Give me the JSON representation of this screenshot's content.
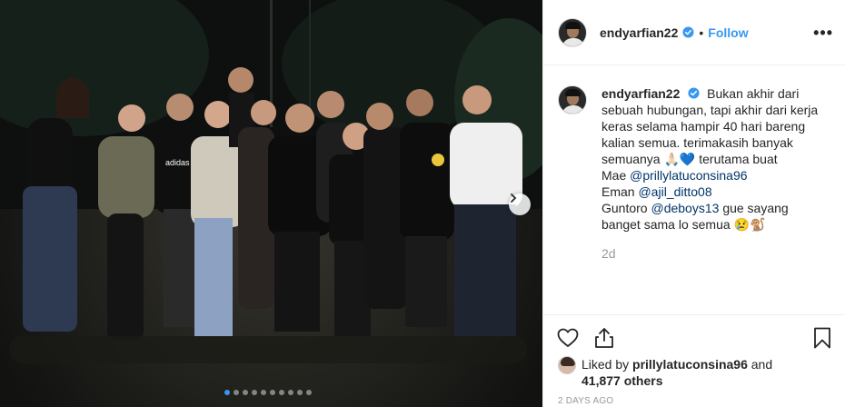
{
  "post": {
    "username": "endyarfian22",
    "follow_label": "Follow",
    "separator": "•",
    "more_label": "•••",
    "caption": {
      "username": "endyarfian22",
      "text_1": "Bukan akhir dari sebuah hubungan, tapi akhir dari kerja keras selama hampir 40 hari bareng kalian semua. terimakasih banyak semuanya",
      "emoji_1": "🙏🏻💙",
      "text_2": "terutama buat",
      "line_mae": "Mae",
      "mention_1": "@prillylatuconsina96",
      "line_eman": "Eman",
      "mention_2": "@ajil_ditto08",
      "line_guntoro": "Guntoro",
      "mention_3": "@deboys13",
      "text_3": "gue sayang banget sama lo semua",
      "emoji_2": "😢🐒",
      "time": "2d"
    },
    "likes": {
      "prefix": "Liked by",
      "user": "prillylatuconsina96",
      "middle": "and",
      "count": "41,877 others"
    },
    "posted_ago": "2 DAYS AGO",
    "carousel": {
      "total": 10,
      "active_index": 0
    }
  },
  "colors": {
    "accent": "#3897f0",
    "mention": "#003569",
    "muted": "#999999"
  },
  "icons": [
    "verified-badge-icon",
    "heart-icon",
    "share-icon",
    "bookmark-icon",
    "chevron-right-icon",
    "more-icon"
  ]
}
